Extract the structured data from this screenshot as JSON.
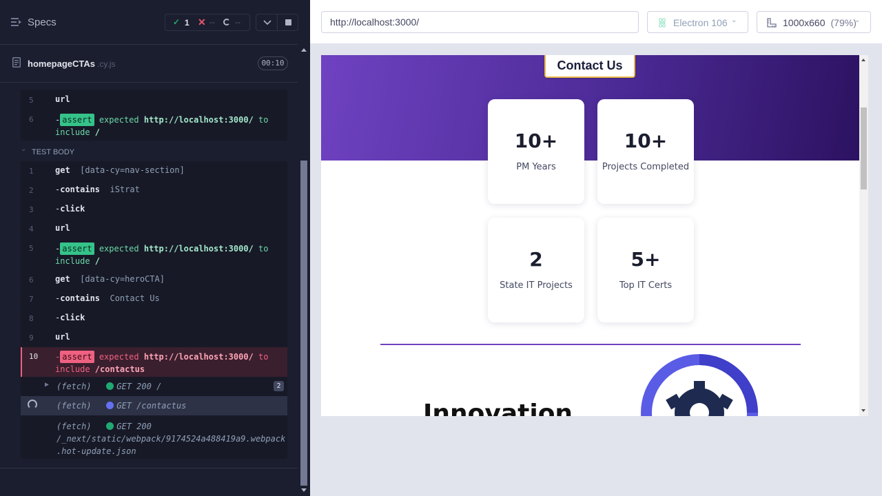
{
  "reporter": {
    "specs_label": "Specs",
    "stats": {
      "passed": "1",
      "failed": "--",
      "pending": "--"
    },
    "file": {
      "name": "homepageCTAs",
      "ext": ".cy.js",
      "duration": "00:10"
    },
    "section_label": "TEST BODY",
    "hook_rows": [
      {
        "line": "5",
        "cmd": "url"
      },
      {
        "line": "6",
        "prefix": "-",
        "badge": "assert",
        "text_a": "expected ",
        "value_a": "http://localhost:3000/",
        "text_b": " to",
        "text_c": "include ",
        "value_b": "/"
      }
    ],
    "body_rows": [
      {
        "line": "1",
        "cmd": "get",
        "arg": "[data-cy=nav-section]"
      },
      {
        "line": "2",
        "prefix": "-",
        "cmd": "contains",
        "arg": "iStrat"
      },
      {
        "line": "3",
        "prefix": "-",
        "cmd": "click",
        "arg": ""
      },
      {
        "line": "4",
        "cmd": "url",
        "arg": ""
      },
      {
        "line": "5",
        "prefix": "-",
        "badge": "assert",
        "text_a": "expected ",
        "value_a": "http://localhost:3000/",
        "text_b": " to",
        "text_c": "include ",
        "value_b": "/"
      },
      {
        "line": "6",
        "cmd": "get",
        "arg": "[data-cy=heroCTA]"
      },
      {
        "line": "7",
        "prefix": "-",
        "cmd": "contains",
        "arg": "Contact Us"
      },
      {
        "line": "8",
        "prefix": "-",
        "cmd": "click",
        "arg": ""
      },
      {
        "line": "9",
        "cmd": "url",
        "arg": ""
      },
      {
        "line": "10",
        "prefix": "-",
        "badge": "assert",
        "text_a": "expected ",
        "value_a": "http://localhost:3000/",
        "text_b": " to",
        "text_c": "include ",
        "value_b": "/contactus"
      }
    ],
    "fetch_rows": [
      {
        "label": "(fetch)",
        "text": "GET 200 /",
        "count": "2",
        "status_color": "#1fa971"
      },
      {
        "label": "(fetch)",
        "text": "GET /contactus",
        "status_color": "#6470f3"
      },
      {
        "label": "(fetch)",
        "text": "GET 200",
        "path_1": "/_next/static/webpack/9174524a488419a9.webpack",
        "path_2": ".hot-update.json",
        "status_color": "#1fa971"
      }
    ]
  },
  "topbar": {
    "url": "http://localhost:3000/",
    "browser": "Electron 106",
    "viewport": "1000x660",
    "zoom": "(79%)"
  },
  "aut": {
    "contact_button": "Contact Us",
    "stats": [
      {
        "value": "10+",
        "label": "PM Years"
      },
      {
        "value": "10+",
        "label": "Projects Completed"
      },
      {
        "value": "2",
        "label": "State IT Projects"
      },
      {
        "value": "5+",
        "label": "Top IT Certs"
      }
    ],
    "heading": "Innovation"
  },
  "colors": {
    "reporter_bg": "#1b1e2e",
    "pass": "#1fa971",
    "fail": "#e45770",
    "hero_start": "#6f42c1",
    "hero_end": "#2c1261",
    "cta_border": "#e9b949"
  }
}
